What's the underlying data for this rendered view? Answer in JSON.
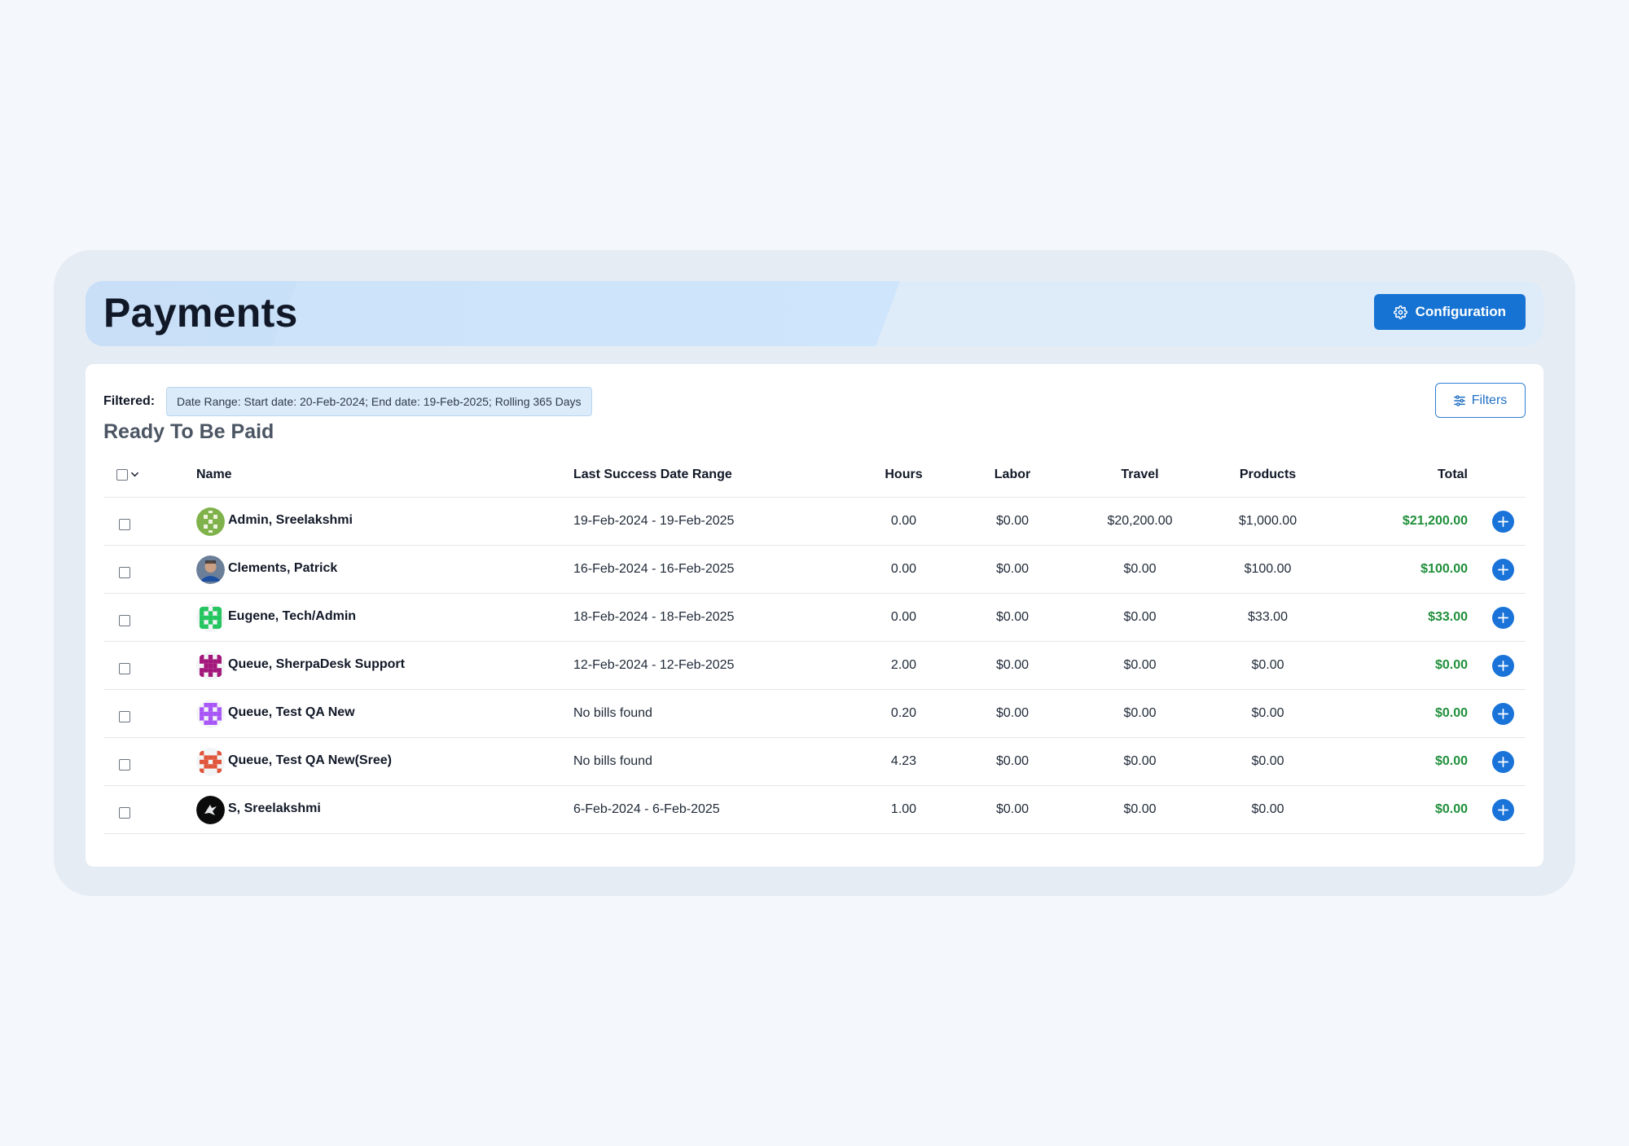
{
  "header": {
    "title": "Payments",
    "config_label": "Configuration"
  },
  "filter": {
    "label": "Filtered:",
    "chip": "Date Range: Start date: 20-Feb-2024; End date: 19-Feb-2025; Rolling 365 Days",
    "button_label": "Filters"
  },
  "section": {
    "title": "Ready To Be Paid"
  },
  "table": {
    "columns": {
      "name": "Name",
      "range": "Last Success Date Range",
      "hours": "Hours",
      "labor": "Labor",
      "travel": "Travel",
      "products": "Products",
      "total": "Total"
    },
    "rows": [
      {
        "name": "Admin, Sreelakshmi",
        "range": "19-Feb-2024 - 19-Feb-2025",
        "hours": "0.00",
        "labor": "$0.00",
        "travel": "$20,200.00",
        "products": "$1,000.00",
        "total": "$21,200.00",
        "avatar": "identicon-olive"
      },
      {
        "name": "Clements, Patrick",
        "range": "16-Feb-2024 - 16-Feb-2025",
        "hours": "0.00",
        "labor": "$0.00",
        "travel": "$0.00",
        "products": "$100.00",
        "total": "$100.00",
        "avatar": "photo"
      },
      {
        "name": "Eugene, Tech/Admin",
        "range": "18-Feb-2024 - 18-Feb-2025",
        "hours": "0.00",
        "labor": "$0.00",
        "travel": "$0.00",
        "products": "$33.00",
        "total": "$33.00",
        "avatar": "identicon-green"
      },
      {
        "name": "Queue, SherpaDesk Support",
        "range": "12-Feb-2024 - 12-Feb-2025",
        "hours": "2.00",
        "labor": "$0.00",
        "travel": "$0.00",
        "products": "$0.00",
        "total": "$0.00",
        "avatar": "identicon-magenta"
      },
      {
        "name": "Queue, Test QA New",
        "range": "No bills found",
        "hours": "0.20",
        "labor": "$0.00",
        "travel": "$0.00",
        "products": "$0.00",
        "total": "$0.00",
        "avatar": "identicon-purple"
      },
      {
        "name": "Queue, Test QA New(Sree)",
        "range": "No bills found",
        "hours": "4.23",
        "labor": "$0.00",
        "travel": "$0.00",
        "products": "$0.00",
        "total": "$0.00",
        "avatar": "identicon-red"
      },
      {
        "name": "S, Sreelakshmi",
        "range": "6-Feb-2024 - 6-Feb-2025",
        "hours": "1.00",
        "labor": "$0.00",
        "travel": "$0.00",
        "products": "$0.00",
        "total": "$0.00",
        "avatar": "logo-black"
      }
    ]
  },
  "colors": {
    "accent": "#1673d3",
    "total_green": "#1f8f3a",
    "avatar_olive": "#7fb24a",
    "avatar_green": "#22c55e",
    "avatar_magenta": "#a3167a",
    "avatar_purple": "#a855f7",
    "avatar_red": "#e0553b"
  },
  "icons": {
    "config": "gear-icon",
    "filters": "sliders-icon",
    "add": "plus-circle-icon",
    "select_all": "chevron-down-icon"
  }
}
